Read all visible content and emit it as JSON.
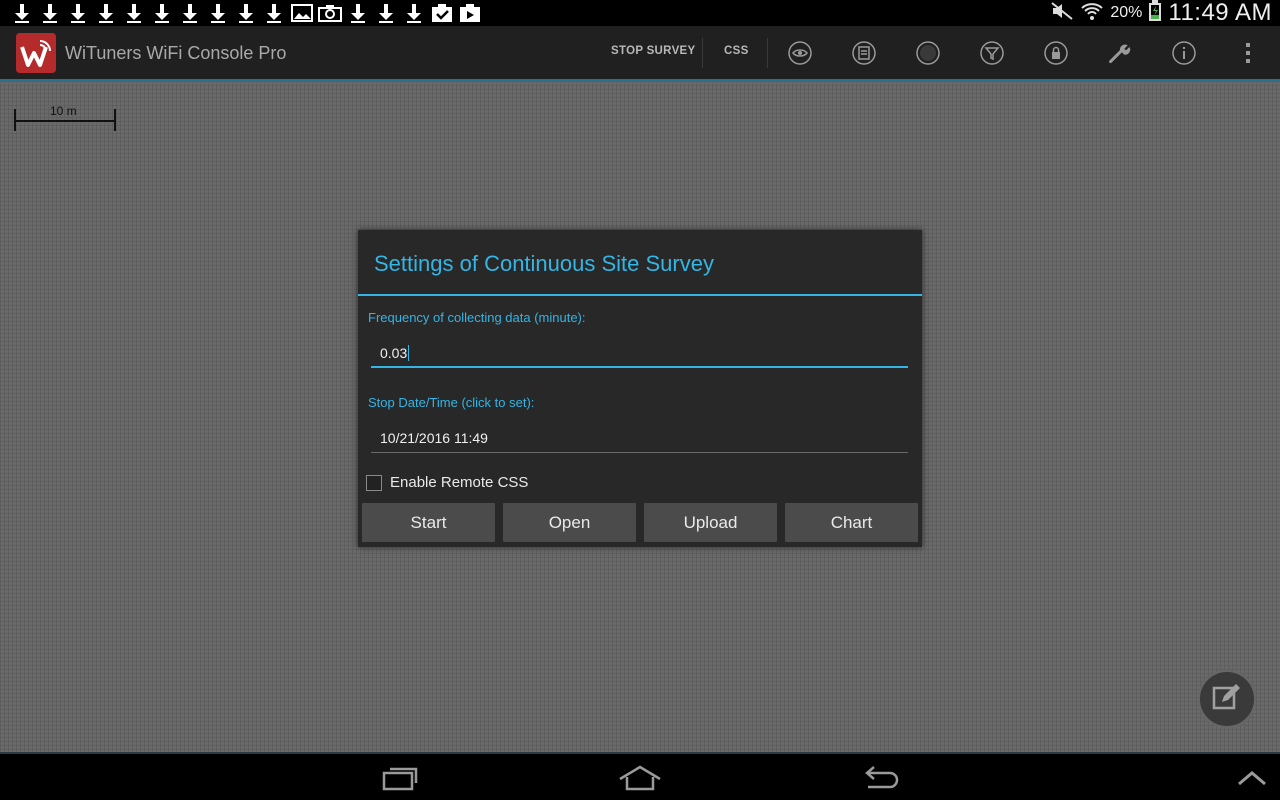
{
  "status_bar": {
    "notification_icons": [
      "download-icon",
      "download-icon",
      "download-icon",
      "download-icon",
      "download-icon",
      "download-icon",
      "download-icon",
      "download-icon",
      "download-icon",
      "download-icon",
      "image-icon",
      "camera-icon",
      "download-icon",
      "download-icon",
      "download-icon",
      "clipboard-check-icon",
      "play-store-icon"
    ],
    "battery_percent": "20%",
    "time": "11:49 AM"
  },
  "action_bar": {
    "app_title": "WiTuners WiFi Console Pro",
    "stop_survey_label": "STOP SURVEY",
    "css_label": "CSS",
    "icons": [
      "eye-icon",
      "list-icon",
      "record-icon",
      "filter-icon",
      "lock-icon",
      "wrench-icon",
      "info-icon",
      "overflow-menu-icon"
    ]
  },
  "map": {
    "scale_label": "10 m"
  },
  "dialog": {
    "title": "Settings of Continuous Site Survey",
    "frequency_label": "Frequency of collecting data (minute):",
    "frequency_value": "0.03",
    "stop_label": "Stop Date/Time (click to set):",
    "stop_value": "10/21/2016 11:49",
    "enable_remote_css_label": "Enable Remote CSS",
    "enable_remote_css_checked": false,
    "buttons": {
      "start": "Start",
      "open": "Open",
      "upload": "Upload",
      "chart": "Chart"
    }
  },
  "colors": {
    "accent": "#33b5e5",
    "dialog_bg": "#282828",
    "button_bg": "#4b4b4b"
  }
}
